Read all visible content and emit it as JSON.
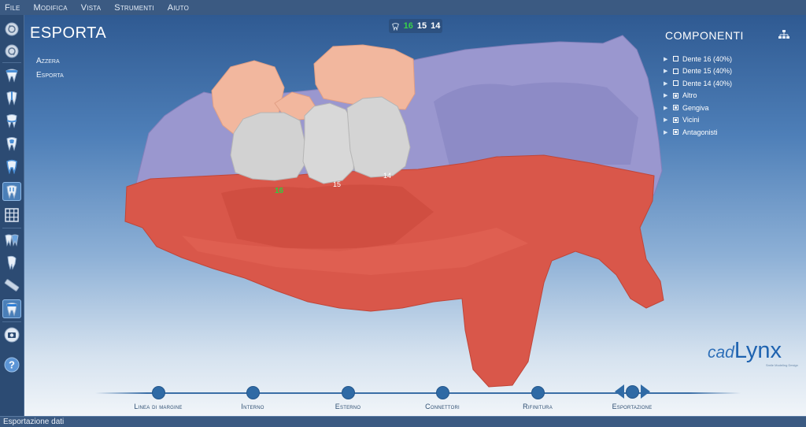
{
  "menu": [
    "File",
    "Modifica",
    "Vista",
    "Strumenti",
    "Aiuto"
  ],
  "page_title": "ESPORTA",
  "side_links": [
    "Azzera",
    "Esporta"
  ],
  "tooth_indicator": {
    "t16": "16",
    "t15": "15",
    "t14": "14"
  },
  "components": {
    "title": "COMPONENTI",
    "items": [
      {
        "label": "Dente 16 (40%)",
        "checked": false
      },
      {
        "label": "Dente 15 (40%)",
        "checked": false
      },
      {
        "label": "Dente 14 (40%)",
        "checked": false
      },
      {
        "label": "Altro",
        "checked": true
      },
      {
        "label": "Gengiva",
        "checked": true
      },
      {
        "label": "Vicini",
        "checked": true
      },
      {
        "label": "Antagonisti",
        "checked": true
      }
    ]
  },
  "scene_labels": {
    "t16": "16",
    "t15": "15",
    "t14": "14"
  },
  "workflow": [
    "Linea di margine",
    "Interno",
    "Esterno",
    "Connettori",
    "Rifinitura",
    "Esportazione"
  ],
  "logo": {
    "cad": "cad",
    "lynx": "Lynx",
    "sub": "Smile Modeling Design"
  },
  "status": "Esportazione dati",
  "colors": {
    "gingiva": "#d9574a",
    "antagonist": "#9a97cf",
    "neighbor": "#f2b79e",
    "crown": "#d2d2d2",
    "accent": "#2f6aa5",
    "active_tooth": "#39d14a"
  },
  "toolbar_icons": [
    "undo-icon",
    "redo-icon",
    "tooth-icon",
    "tooth-section-icon",
    "tooth-margin-icon",
    "tooth-inner-icon",
    "tooth-outer-icon",
    "tooth-connector-icon",
    "grid-icon",
    "tooth-pair-icon",
    "tooth-side-icon",
    "ruler-icon",
    "tooth-export-icon",
    "camera-icon",
    "help-icon"
  ]
}
